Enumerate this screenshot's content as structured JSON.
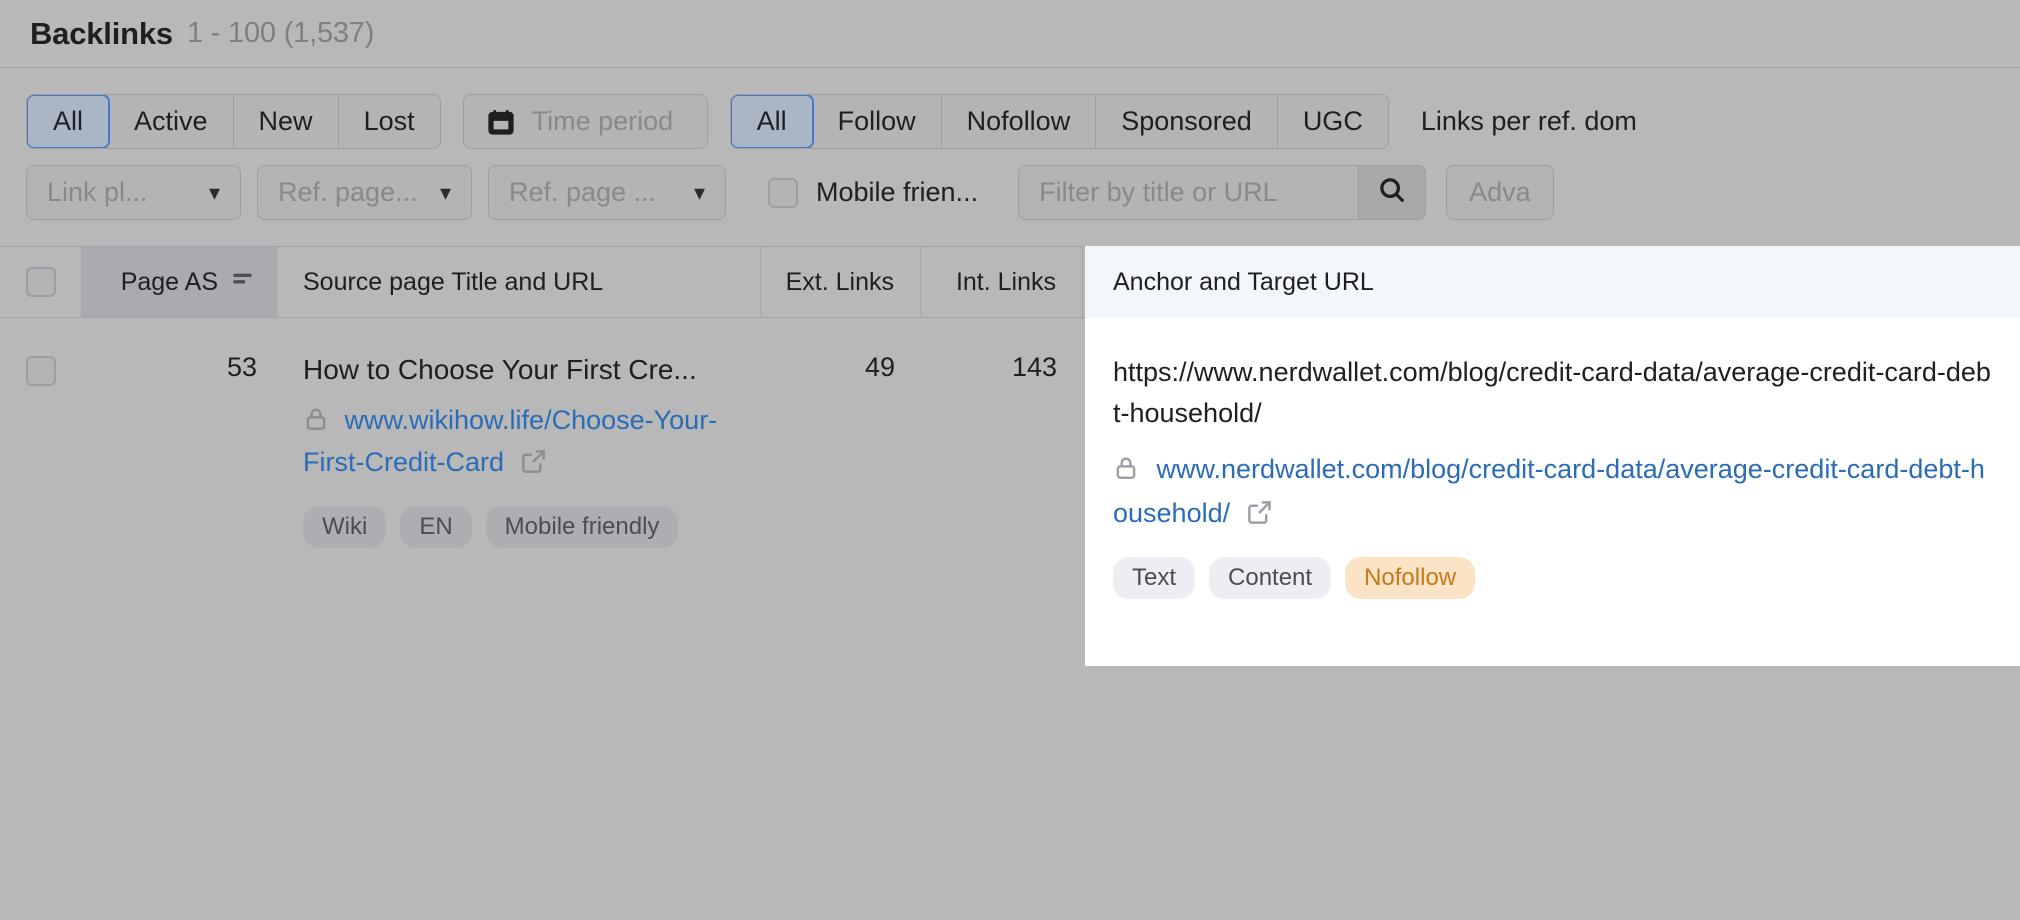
{
  "header": {
    "title": "Backlinks",
    "count": "1 - 100 (1,537)"
  },
  "filters": {
    "status_group": {
      "options": [
        "All",
        "Active",
        "New",
        "Lost"
      ],
      "selected": "All"
    },
    "time_period": {
      "label": "Time period",
      "icon": "calendar-icon"
    },
    "follow_group": {
      "options": [
        "All",
        "Follow",
        "Nofollow",
        "Sponsored",
        "UGC"
      ],
      "selected": "All"
    },
    "links_per_ref_domain_label": "Links per ref. dom",
    "dropdowns": [
      {
        "label": "Link pl...",
        "name": "link-placement"
      },
      {
        "label": "Ref. page...",
        "name": "ref-page-platform"
      },
      {
        "label": "Ref. page ...",
        "name": "ref-page-language"
      }
    ],
    "mobile_friendly": {
      "label": "Mobile frien...",
      "checked": false
    },
    "search": {
      "placeholder": "Filter by title or URL",
      "value": "",
      "icon": "search-icon"
    },
    "advanced_label": "Adva"
  },
  "table": {
    "columns": [
      {
        "key": "select",
        "label": ""
      },
      {
        "key": "page_as",
        "label": "Page AS",
        "sorted": true,
        "sort_icon": "sort-icon"
      },
      {
        "key": "source",
        "label": "Source page Title and URL"
      },
      {
        "key": "ext",
        "label": "Ext. Links"
      },
      {
        "key": "int",
        "label": "Int. Links"
      },
      {
        "key": "anchor",
        "label": "Anchor and Target URL"
      }
    ],
    "rows": [
      {
        "page_as": "53",
        "source_title": "How to Choose Your First Cre...",
        "source_url": "www.wikihow.life/Choose-Your-First-Credit-Card",
        "source_tags": [
          "Wiki",
          "EN",
          "Mobile friendly"
        ],
        "ext_links": "49",
        "int_links": "143"
      }
    ]
  },
  "anchor_panel": {
    "header": "Anchor and Target URL",
    "target_url": "https://www.nerdwallet.com/blog/credit-card-data/average-credit-card-debt-household/",
    "display_url": "www.nerdwallet.com/blog/credit-card-data/average-credit-card-debt-household/",
    "tags": [
      {
        "label": "Text",
        "style": "light"
      },
      {
        "label": "Content",
        "style": "light"
      },
      {
        "label": "Nofollow",
        "style": "warn"
      }
    ],
    "warn_color": "#c6791c"
  }
}
